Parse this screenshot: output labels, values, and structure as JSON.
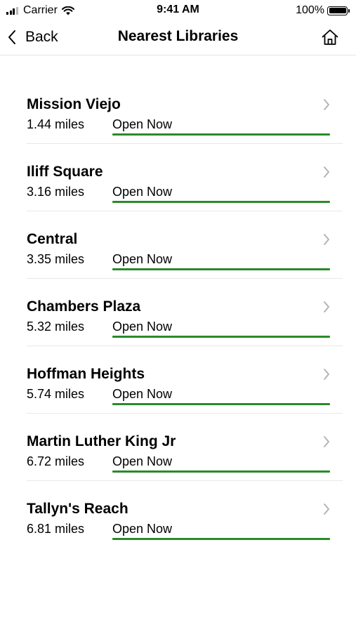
{
  "status_bar": {
    "carrier": "Carrier",
    "time": "9:41 AM",
    "battery": "100%"
  },
  "nav": {
    "back_label": "Back",
    "title": "Nearest Libraries",
    "home_icon": "home-icon"
  },
  "colors": {
    "open_underline": "#2a8a2a",
    "divider": "#e8e8e8",
    "chevron": "#b0b0b0"
  },
  "libraries": [
    {
      "name": "Mission Viejo",
      "distance": "1.44 miles",
      "status": "Open Now"
    },
    {
      "name": "Iliff Square",
      "distance": "3.16 miles",
      "status": "Open Now"
    },
    {
      "name": "Central",
      "distance": "3.35 miles",
      "status": "Open Now"
    },
    {
      "name": "Chambers Plaza",
      "distance": "5.32 miles",
      "status": "Open Now"
    },
    {
      "name": "Hoffman Heights",
      "distance": "5.74 miles",
      "status": "Open Now"
    },
    {
      "name": "Martin Luther King Jr",
      "distance": "6.72 miles",
      "status": "Open Now"
    },
    {
      "name": "Tallyn's Reach",
      "distance": "6.81 miles",
      "status": "Open Now"
    }
  ]
}
